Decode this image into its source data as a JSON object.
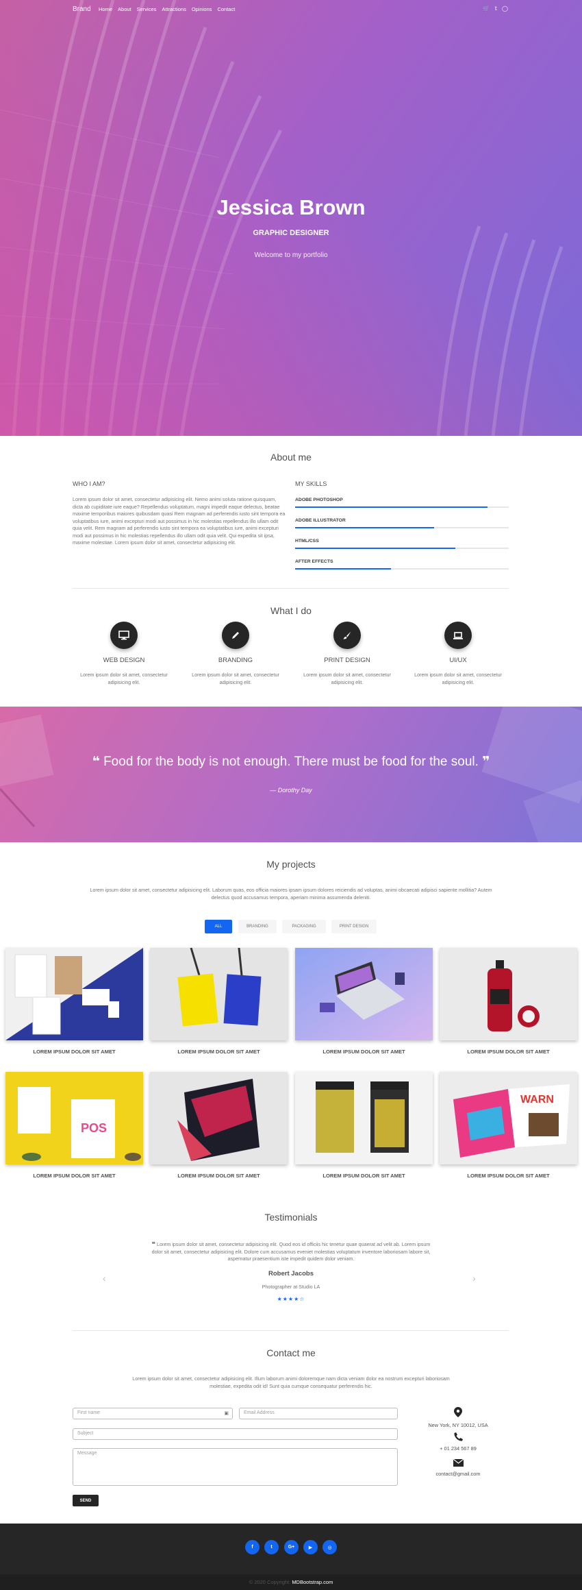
{
  "nav": {
    "brand": "Brand",
    "links": [
      "Home",
      "About",
      "Services",
      "Attractions",
      "Opinions",
      "Contact"
    ],
    "icons": [
      "cart-icon",
      "twitter-icon",
      "instagram-icon"
    ]
  },
  "hero": {
    "name": "Jessica Brown",
    "role": "GRAPHIC DESIGNER",
    "welcome": "Welcome to my portfolio"
  },
  "about": {
    "title": "About me",
    "who_title": "WHO I AM?",
    "who_text": "Lorem ipsum dolor sit amet, consectetur adipisicing elit. Nemo animi soluta ratione quisquam, dicta ab cupiditate iure eaque? Repellendus voluptatum, magni impedit eaque delectus, beatae maxime temporibus maiores quibusdam quasi Rem magnam ad perferendis iusto sint tempora ea voluptatibus iure, animi excepturi modi aut possimus in hic molestias repellendus illo ullam odit quia velit. Rem magnam ad perferendis iusto sint tempora ea voluptatibus iure, animi excepturi modi aut possimus in hic molestias repellendus illo ullam odit quia velit. Qui expedita sit ipsa, maxime molestiae. Lorem ipsum dolor sit amet, consectetur adipisicing elit.",
    "skills_title": "MY SKILLS",
    "skills": [
      {
        "label": "ADOBE PHOTOSHOP",
        "level": 0.9
      },
      {
        "label": "ADOBE ILLUSTRATOR",
        "level": 0.65
      },
      {
        "label": "HTML/CSS",
        "level": 0.75
      },
      {
        "label": "AFTER EFFECTS",
        "level": 0.45
      }
    ]
  },
  "services": {
    "title": "What I do",
    "items": [
      {
        "icon": "monitor-icon",
        "title": "WEB DESIGN",
        "text": "Lorem ipsum dolor sit amet, consectetur adipisicing elit."
      },
      {
        "icon": "pencil-icon",
        "title": "BRANDING",
        "text": "Lorem ipsum dolor sit amet, consectetur adipisicing elit."
      },
      {
        "icon": "brush-icon",
        "title": "PRINT DESIGN",
        "text": "Lorem ipsum dolor sit amet, consectetur adipisicing elit."
      },
      {
        "icon": "laptop-icon",
        "title": "UI/UX",
        "text": "Lorem ipsum dolor sit amet, consectetur adipisicing elit."
      }
    ]
  },
  "quote": {
    "text": "Food for the body is not enough. There must be food for the soul.",
    "author": "— Dorothy Day"
  },
  "projects": {
    "title": "My projects",
    "intro": "Lorem ipsum dolor sit amet, consectetur adipisicing elit. Laborum quas, eos officia maiores ipsam ipsum dolores reiciendis ad voluptas, animi obcaecati adipisci sapiente mollitia? Autem delectus quod accusamus tempora, aperiam minima assumenda deleniti.",
    "filters": [
      "ALL",
      "BRANDING",
      "PACKAGING",
      "PRINT DESIGN"
    ],
    "active_filter": "ALL",
    "items": [
      "LOREM IPSUM DOLOR SIT AMET",
      "LOREM IPSUM DOLOR SIT AMET",
      "LOREM IPSUM DOLOR SIT AMET",
      "LOREM IPSUM DOLOR SIT AMET",
      "LOREM IPSUM DOLOR SIT AMET",
      "LOREM IPSUM DOLOR SIT AMET",
      "LOREM IPSUM DOLOR SIT AMET",
      "LOREM IPSUM DOLOR SIT AMET"
    ]
  },
  "testimonials": {
    "title": "Testimonials",
    "text": "Lorem ipsum dolor sit amet, consectetur adipisicing elit. Quod eos id officiis hic tenetur quae quaerat ad velit ab. Lorem ipsum dolor sit amet, consectetur adipisicing elit. Dolore cum accusamus eveniet molestias voluptatum inventore laboriosam labore sit, aspernatur praesentium iste impedit quidem dolor veniam.",
    "name": "Robert Jacobs",
    "role": "Photographer at Studio LA",
    "rating": 4.5,
    "stars": "★★★★☆"
  },
  "contact": {
    "title": "Contact me",
    "intro": "Lorem ipsum dolor sit amet, consectetur adipisicing elit. Illum laborum animi doloremque nam dicta veniam dolor ea nostrum excepturi laboriosam molestiae, expedita odit id! Sunt quia cumque consequatur perferendis hic.",
    "placeholders": {
      "first_name": "First name",
      "email": "Email Address",
      "subject": "Subject",
      "message": "Message"
    },
    "send_label": "SEND",
    "address": "New York, NY 10012, USA",
    "phone": "+ 01 234 567 89",
    "email": "contact@gmail.com"
  },
  "footer": {
    "social": [
      "f",
      "t",
      "G+",
      "▶",
      "◎"
    ],
    "copyright": "© 2020 Copyright:",
    "site": "MDBootstrap.com"
  },
  "colors": {
    "accent": "#1266f1",
    "dark": "#262626",
    "hero_pink": "#d05a9f",
    "hero_purple": "#7a6ad8"
  }
}
